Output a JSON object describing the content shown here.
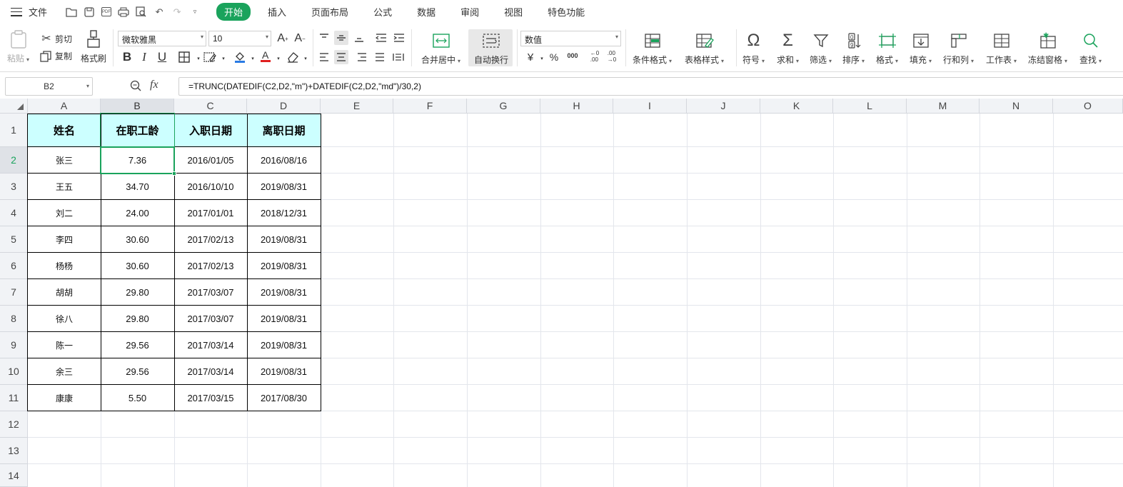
{
  "menubar": {
    "file_label": "文件",
    "tabs": [
      {
        "label": "开始",
        "active": true
      },
      {
        "label": "插入"
      },
      {
        "label": "页面布局"
      },
      {
        "label": "公式"
      },
      {
        "label": "数据"
      },
      {
        "label": "审阅"
      },
      {
        "label": "视图"
      },
      {
        "label": "特色功能"
      }
    ],
    "quick_access_icons": [
      "open-folder-icon",
      "save-icon",
      "pdf-icon",
      "print-icon",
      "print-preview-icon",
      "undo-icon",
      "redo-icon",
      "customize-icon"
    ]
  },
  "ribbon": {
    "paste": "粘贴",
    "cut": "剪切",
    "copy": "复制",
    "format_painter": "格式刷",
    "font_name": "微软雅黑",
    "font_size": "10",
    "merge_center": "合并居中",
    "wrap_text": "自动换行",
    "number_format": "数值",
    "currency_symbol": "¥",
    "percent_symbol": "%",
    "thousands_symbol": "000",
    "conditional_format": "条件格式",
    "table_style": "表格样式",
    "symbol": "符号",
    "sum": "求和",
    "filter": "筛选",
    "sort": "排序",
    "format": "格式",
    "fill": "填充",
    "rows_cols": "行和列",
    "worksheet": "工作表",
    "freeze_panes": "冻结窗格",
    "find": "查找"
  },
  "formula_bar": {
    "name_box": "B2",
    "formula": "=TRUNC(DATEDIF(C2,D2,\"m\")+DATEDIF(C2,D2,\"md\")/30,2)"
  },
  "sheet": {
    "columns": [
      "A",
      "B",
      "C",
      "D",
      "E",
      "F",
      "G",
      "H",
      "I",
      "J",
      "K",
      "L",
      "M",
      "N",
      "O"
    ],
    "rows": [
      "1",
      "2",
      "3",
      "4",
      "5",
      "6",
      "7",
      "8",
      "9",
      "10",
      "11",
      "12",
      "13",
      "14"
    ],
    "selected_cell": "B2",
    "header_fill": "#ccffff",
    "accent": "#1aa35c",
    "headers": [
      "姓名",
      "在职工龄",
      "入职日期",
      "离职日期"
    ],
    "data": [
      [
        "张三",
        "7.36",
        "2016/01/05",
        "2016/08/16"
      ],
      [
        "王五",
        "34.70",
        "2016/10/10",
        "2019/08/31"
      ],
      [
        "刘二",
        "24.00",
        "2017/01/01",
        "2018/12/31"
      ],
      [
        "李四",
        "30.60",
        "2017/02/13",
        "2019/08/31"
      ],
      [
        "杨杨",
        "30.60",
        "2017/02/13",
        "2019/08/31"
      ],
      [
        "胡胡",
        "29.80",
        "2017/03/07",
        "2019/08/31"
      ],
      [
        "徐八",
        "29.80",
        "2017/03/07",
        "2019/08/31"
      ],
      [
        "陈一",
        "29.56",
        "2017/03/14",
        "2019/08/31"
      ],
      [
        "余三",
        "29.56",
        "2017/03/14",
        "2019/08/31"
      ],
      [
        "康康",
        "5.50",
        "2017/03/15",
        "2017/08/30"
      ]
    ]
  }
}
